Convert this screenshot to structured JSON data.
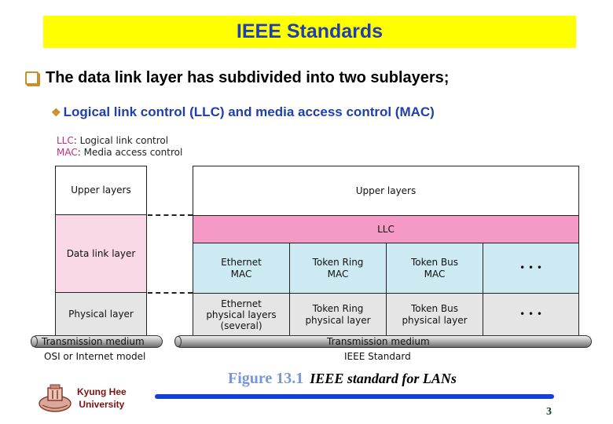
{
  "slide": {
    "title": "IEEE Standards",
    "bullet_main": "The data link layer has subdivided into two sublayers;",
    "bullet_sub": "Logical link control (LLC) and media access control (MAC)",
    "page_number": "3",
    "colors": {
      "title_bg": "#ffff00",
      "title_text": "#1f3fae",
      "sub_bullet_text": "#1f3fae",
      "bullet_icon": "#c8902a",
      "footer_line": "#1540d6"
    }
  },
  "diagram": {
    "legend": [
      {
        "abbr": "LLC",
        "meaning": ": Logical link control"
      },
      {
        "abbr": "MAC",
        "meaning": ": Media access control"
      }
    ],
    "osi_model": {
      "layers": [
        "Upper layers",
        "Data link layer",
        "Physical layer"
      ],
      "medium": "Transmission medium",
      "caption": "OSI or Internet model"
    },
    "ieee_standard": {
      "upper": "Upper layers",
      "llc": "LLC",
      "mac_row": [
        "Ethernet\nMAC",
        "Token Ring\nMAC",
        "Token Bus\nMAC",
        "• • •"
      ],
      "phy_row": [
        "Ethernet\nphysical layers\n(several)",
        "Token Ring\nphysical layer",
        "Token Bus\nphysical layer",
        "• • •"
      ],
      "medium": "Transmission medium",
      "caption": "IEEE Standard"
    },
    "colors": {
      "upper": "#ffffff",
      "data_link": "#f9d8e8",
      "llc": "#f59ac7",
      "mac": "#cdeaf2",
      "physical": "#e5e5e5"
    }
  },
  "footer": {
    "university_line1": "Kyung Hee",
    "university_line2": "University",
    "figure_number": "Figure 13.1",
    "figure_title": "IEEE standard for LANs"
  }
}
